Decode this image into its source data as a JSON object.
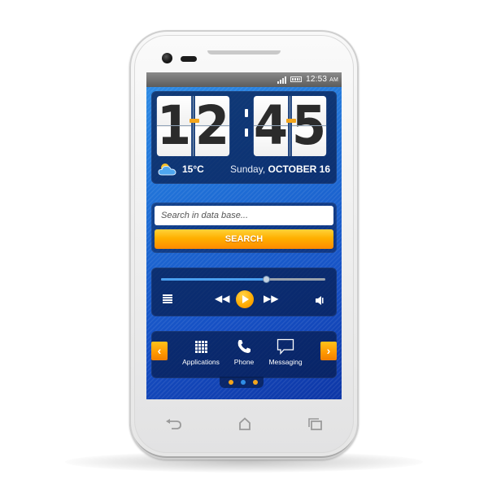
{
  "status_bar": {
    "time": "12:53",
    "ampm": "AM",
    "signal_icon": "signal-bars-icon",
    "battery_icon": "battery-icon"
  },
  "clock_widget": {
    "digits": [
      "1",
      "2",
      "4",
      "5"
    ],
    "separator": ":",
    "weather_icon": "partly-cloudy-icon",
    "temperature": "15°C",
    "day": "Sunday,",
    "date": "OCTOBER 16"
  },
  "search": {
    "placeholder": "Search in data base...",
    "value": "",
    "button_label": "SEARCH"
  },
  "player": {
    "progress": 0.64,
    "controls": [
      "playlist-icon",
      "rewind-icon",
      "play-icon",
      "fast-forward-icon",
      "volume-icon"
    ]
  },
  "app_dock": {
    "prev_icon": "chevron-left-icon",
    "next_icon": "chevron-right-icon",
    "apps": [
      {
        "label": "Applications",
        "icon": "grid-icon"
      },
      {
        "label": "Phone",
        "icon": "phone-icon"
      },
      {
        "label": "Messaging",
        "icon": "speech-bubble-icon"
      }
    ],
    "page_count": 3,
    "active_page": 2,
    "colors": {
      "dot_inactive": "#f3a51c",
      "dot_active": "#2f8ee6",
      "accent": "#ff9800"
    }
  },
  "nav_bar": {
    "buttons": [
      "back-icon",
      "home-icon",
      "recent-apps-icon"
    ]
  }
}
